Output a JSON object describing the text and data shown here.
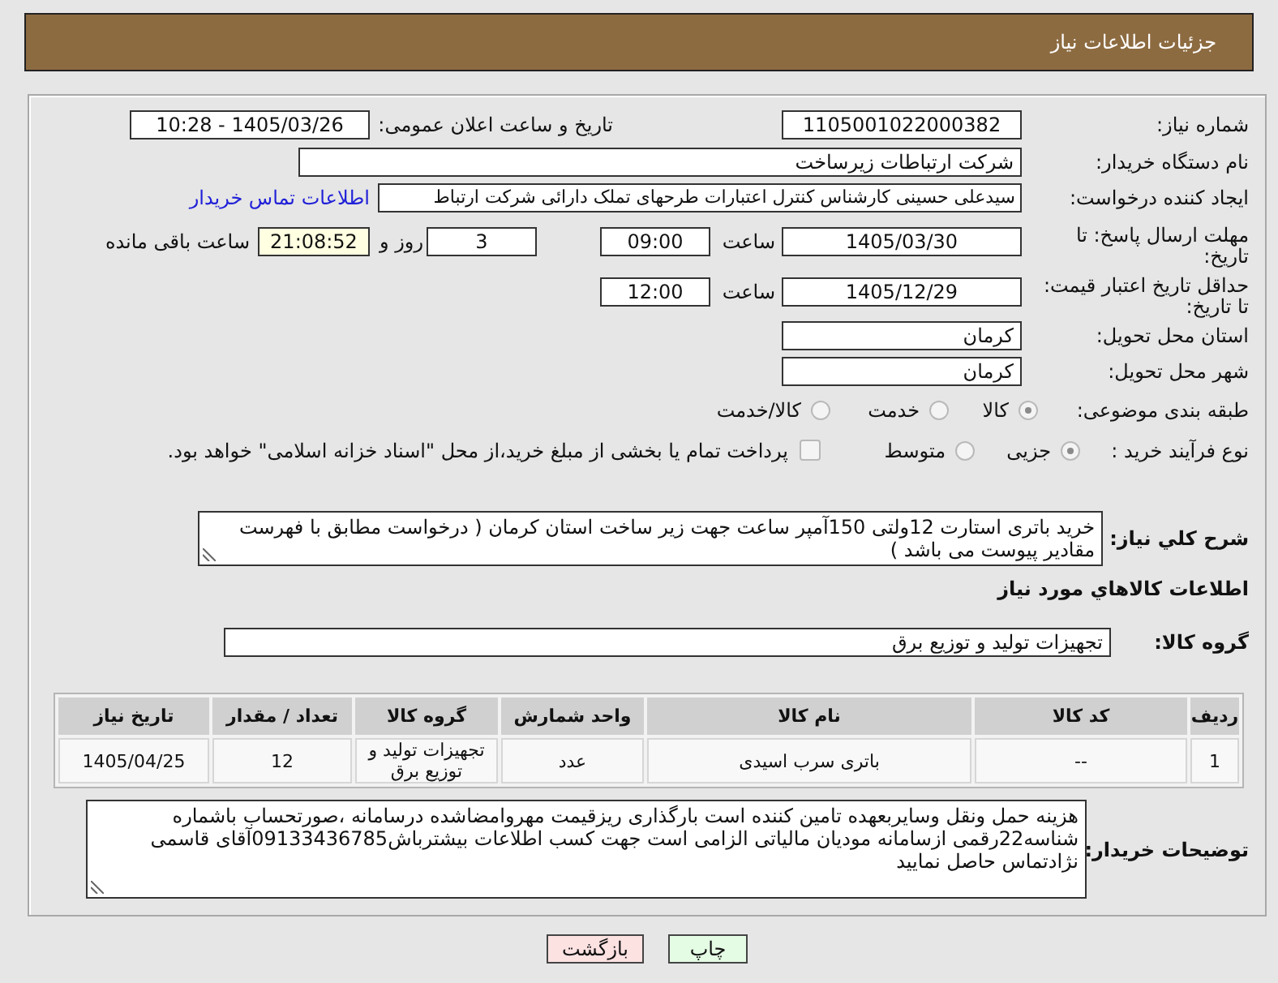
{
  "header": {
    "title": "جزئیات اطلاعات نیاز"
  },
  "form": {
    "need_number": {
      "label": "شماره نیاز:",
      "value": "1105001022000382"
    },
    "announced": {
      "label": "تاریخ و ساعت اعلان عمومی:",
      "value": "1405/03/26 - 10:28"
    },
    "buyer_org": {
      "label": "نام دستگاه خریدار:",
      "value": "شرکت ارتباطات زیرساخت"
    },
    "requester": {
      "label": "ایجاد کننده درخواست:",
      "value": "سیدعلی حسینی کارشناس کنترل اعتبارات طرحهای تملک دارائی شرکت ارتباط",
      "link": "اطلاعات تماس خریدار"
    },
    "response_deadline": {
      "label": "مهلت ارسال پاسخ: تا تاریخ:",
      "date": "1405/03/30",
      "time_label": "ساعت",
      "time": "09:00",
      "days": "3",
      "days_label": "روز و",
      "remaining": "21:08:52",
      "remaining_label": "ساعت باقی مانده"
    },
    "price_validity": {
      "label": "حداقل تاریخ اعتبار قیمت: تا تاریخ:",
      "date": "1405/12/29",
      "time_label": "ساعت",
      "time": "12:00"
    },
    "delivery_province": {
      "label": "استان محل تحویل:",
      "value": "کرمان"
    },
    "delivery_city": {
      "label": "شهر محل تحویل:",
      "value": "کرمان"
    },
    "category": {
      "label": "طبقه بندی موضوعی:",
      "options": [
        {
          "label": "کالا",
          "selected": true
        },
        {
          "label": "خدمت",
          "selected": false
        },
        {
          "label": "کالا/خدمت",
          "selected": false
        }
      ]
    },
    "purchase_process": {
      "label": "نوع فرآیند خرید :",
      "options": [
        {
          "label": "جزیی",
          "selected": true
        },
        {
          "label": "متوسط",
          "selected": false
        }
      ],
      "treasury": {
        "label": "پرداخت تمام یا بخشی از مبلغ خرید،از محل \"اسناد خزانه اسلامی\" خواهد بود.",
        "checked": false
      }
    }
  },
  "description": {
    "label": "شرح کلي نياز:",
    "value": "خرید باتری استارت 12ولتی 150آمپر ساعت جهت زیر ساخت استان کرمان ( درخواست مطابق با فهرست مقادیر پیوست می باشد )"
  },
  "goods": {
    "heading": "اطلاعات کالاهاي مورد نياز",
    "group_label": "گروه کالا:",
    "group": "تجهیزات تولید و توزیع برق",
    "table": {
      "columns": [
        "ردیف",
        "کد کالا",
        "نام کالا",
        "واحد شمارش",
        "گروه کالا",
        "تعداد / مقدار",
        "تاریخ نیاز"
      ],
      "rows": [
        [
          "1",
          "--",
          "باتری سرب اسیدی",
          "عدد",
          "تجهیزات تولید و توزیع برق",
          "12",
          "1405/04/25"
        ]
      ]
    }
  },
  "buyer_notes": {
    "label": "توضیحات خریدار:",
    "value": "هزینه حمل ونقل وسایربعهده تامین کننده است بارگذاری ریزقیمت مهروامضاشده درسامانه ،صورتحساب باشماره شناسه22رقمی ازسامانه مودیان مالیاتی الزامی است جهت کسب اطلاعات بیشترباش09133436785آقای قاسمی نژادتماس حاصل نمایید"
  },
  "buttons": [
    {
      "label": "چاپ",
      "kind": "print"
    },
    {
      "label": "بازگشت",
      "kind": "back"
    }
  ]
}
